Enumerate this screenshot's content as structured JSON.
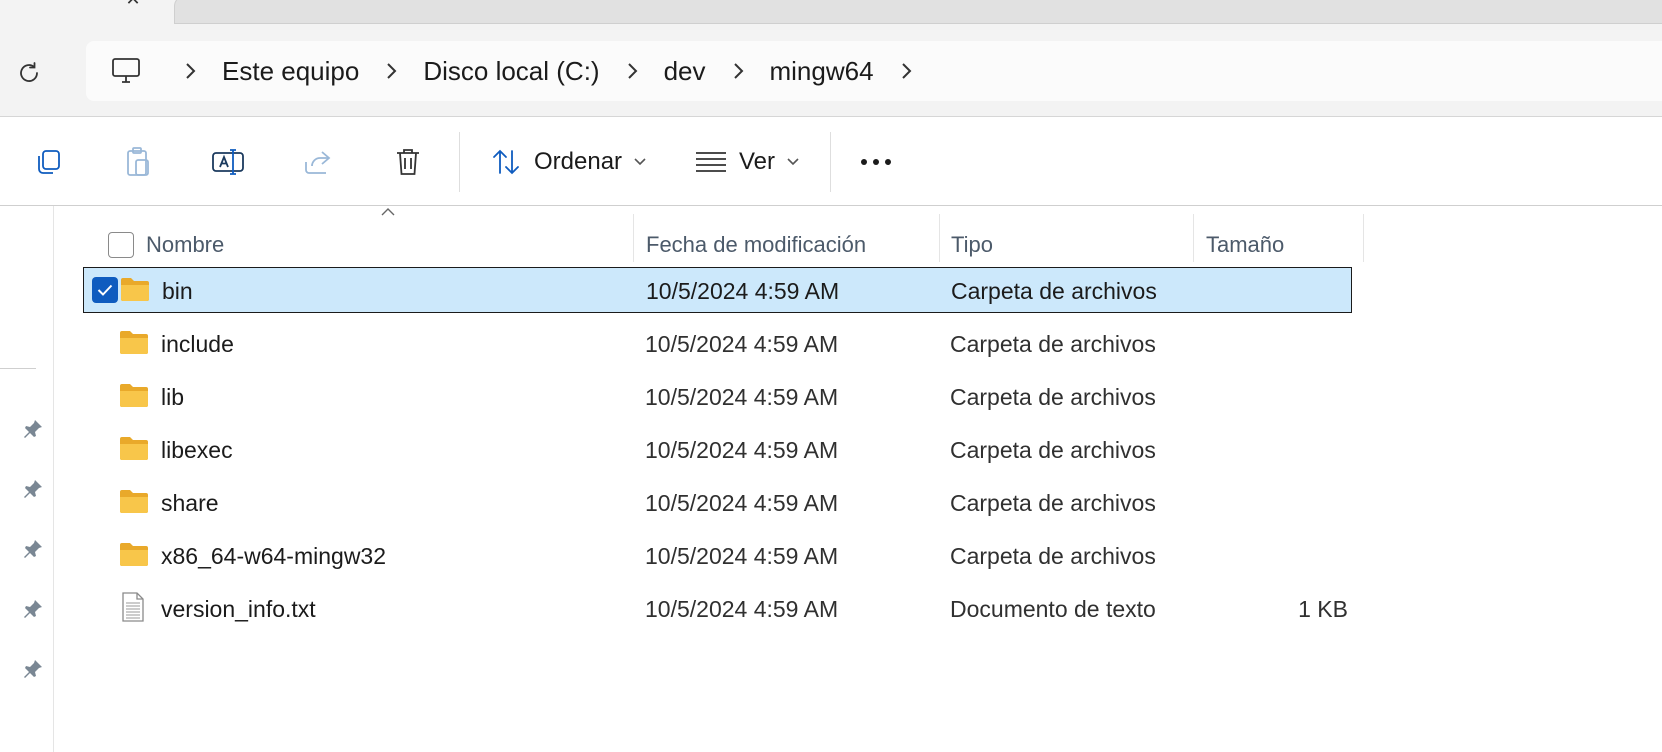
{
  "breadcrumb": {
    "items": [
      "Este equipo",
      "Disco local (C:)",
      "dev",
      "mingw64"
    ]
  },
  "toolbar": {
    "sort_label": "Ordenar",
    "view_label": "Ver"
  },
  "columns": {
    "name": "Nombre",
    "modified": "Fecha de modificación",
    "type": "Tipo",
    "size": "Tamaño"
  },
  "files": [
    {
      "name": "bin",
      "modified": "10/5/2024 4:59 AM",
      "type": "Carpeta de archivos",
      "size": "",
      "icon": "folder-icon",
      "selected": true
    },
    {
      "name": "include",
      "modified": "10/5/2024 4:59 AM",
      "type": "Carpeta de archivos",
      "size": "",
      "icon": "folder-icon",
      "selected": false
    },
    {
      "name": "lib",
      "modified": "10/5/2024 4:59 AM",
      "type": "Carpeta de archivos",
      "size": "",
      "icon": "folder-icon",
      "selected": false
    },
    {
      "name": "libexec",
      "modified": "10/5/2024 4:59 AM",
      "type": "Carpeta de archivos",
      "size": "",
      "icon": "folder-icon",
      "selected": false
    },
    {
      "name": "share",
      "modified": "10/5/2024 4:59 AM",
      "type": "Carpeta de archivos",
      "size": "",
      "icon": "folder-icon",
      "selected": false
    },
    {
      "name": "x86_64-w64-mingw32",
      "modified": "10/5/2024 4:59 AM",
      "type": "Carpeta de archivos",
      "size": "",
      "icon": "folder-icon",
      "selected": false
    },
    {
      "name": "version_info.txt",
      "modified": "10/5/2024 4:59 AM",
      "type": "Documento de texto",
      "size": "1 KB",
      "icon": "text-file-icon",
      "selected": false
    }
  ],
  "colors": {
    "accent": "#0f5cbf",
    "selection": "#cce8fb",
    "folder": "#f8c64a"
  }
}
